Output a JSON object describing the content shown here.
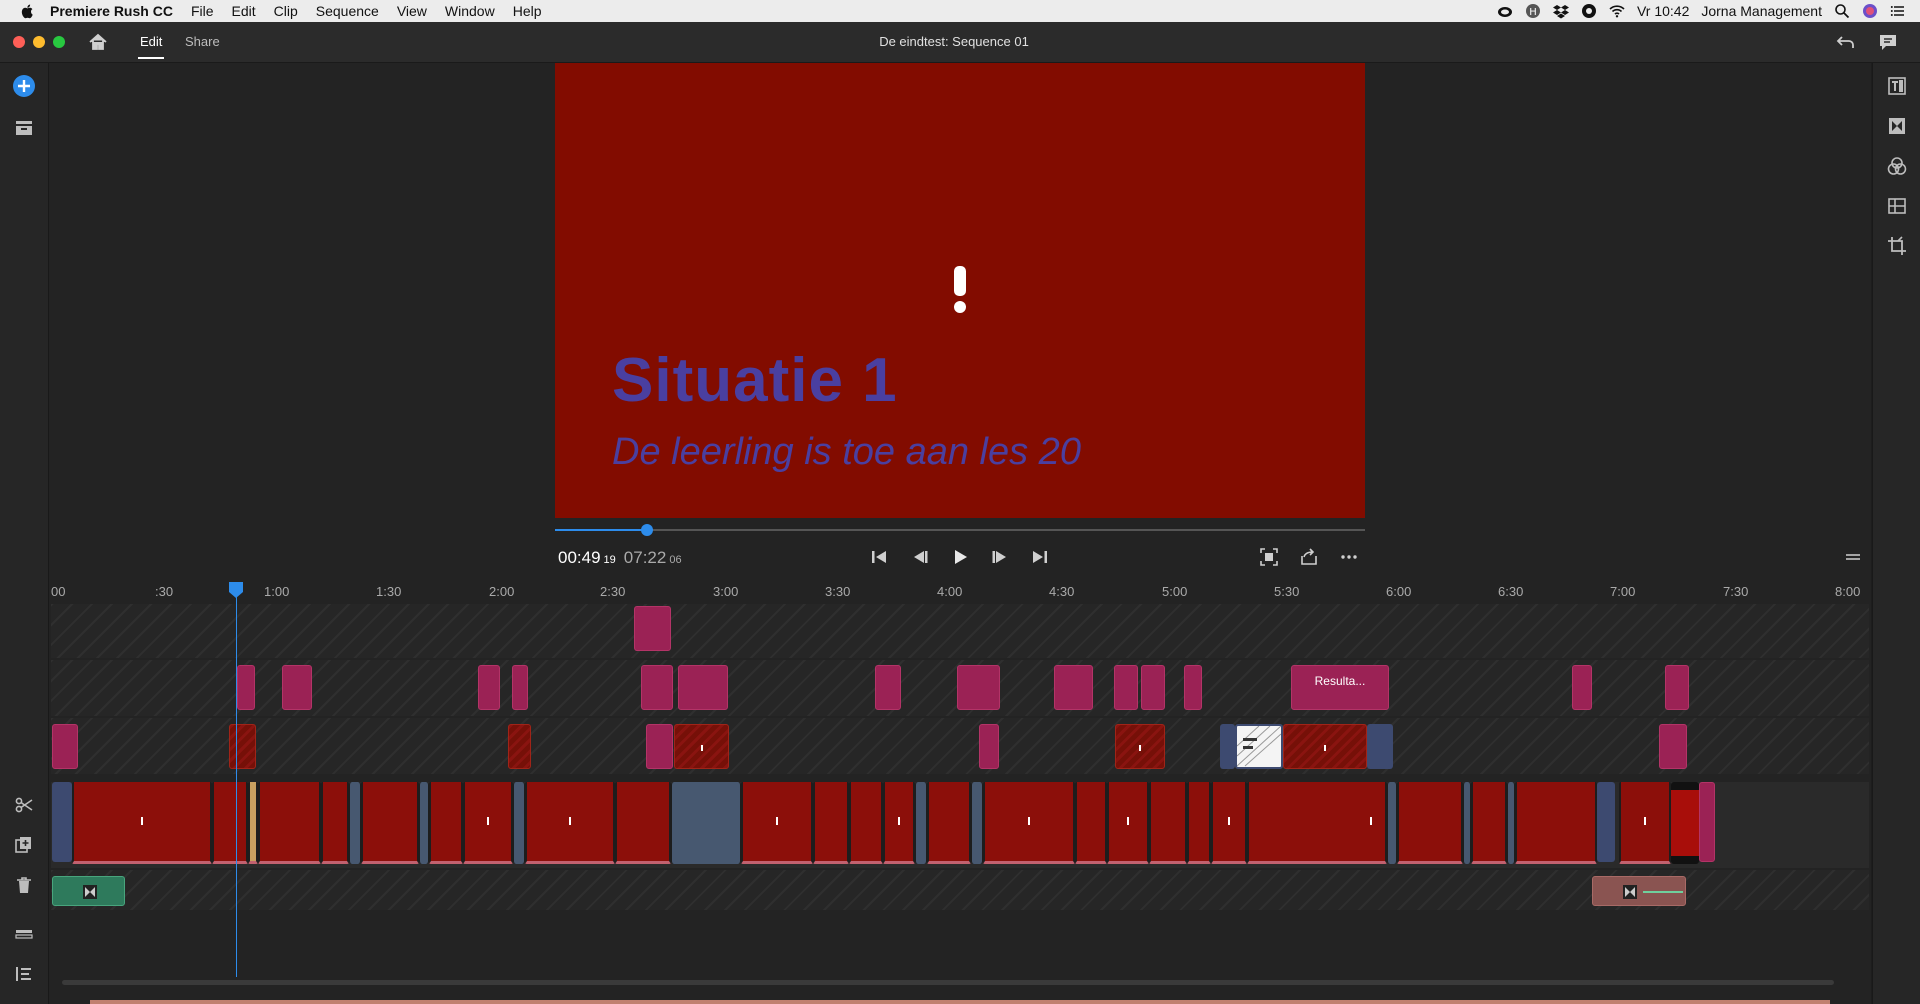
{
  "menubar": {
    "app_name": "Premiere Rush CC",
    "items": [
      "File",
      "Edit",
      "Clip",
      "Sequence",
      "View",
      "Window",
      "Help"
    ],
    "clock": "Vr 10:42",
    "user": "Jorna Management"
  },
  "titlebar": {
    "tabs": [
      "Edit",
      "Share"
    ],
    "active_tab": "Edit",
    "document_title": "De eindtest: Sequence 01"
  },
  "preview": {
    "title": "Situatie 1",
    "subtitle": "De leerling is toe aan les 20",
    "background_color": "#820c00",
    "text_color": "#4a3fa0"
  },
  "playback": {
    "current_time": "00:49",
    "current_frames": "19",
    "total_time": "07:22",
    "total_frames": "06",
    "progress": 0.113
  },
  "timeline": {
    "ruler_labels": [
      "00",
      ":30",
      "1:00",
      "1:30",
      "2:00",
      "2:30",
      "3:00",
      "3:30",
      "4:00",
      "4:30",
      "5:00",
      "5:30",
      "6:00",
      "6:30",
      "7:00",
      "7:30",
      "8:00"
    ],
    "title_clip_label": "Resulta...",
    "playhead_time": "0:49"
  },
  "colors": {
    "accent": "#2d8ceb",
    "title_clip": "#9b2255",
    "video_clip": "#8c0f0a",
    "audio_clip": "#2e7a5c"
  },
  "icons": {
    "left_panel": [
      "add-media-icon",
      "project-media-icon",
      "scissors-icon",
      "duplicate-icon",
      "trash-icon",
      "track-controls-icon",
      "timeline-list-icon"
    ],
    "right_panel": [
      "titles-icon",
      "transitions-icon",
      "color-icon",
      "speed-icon",
      "transform-icon"
    ]
  }
}
